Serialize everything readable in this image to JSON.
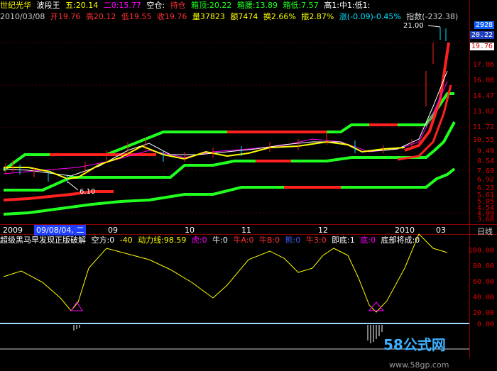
{
  "header": {
    "stock_name": "世纪光华",
    "indicator": "波段王",
    "five_label": "五:20.14",
    "two_label": "二0:15.77",
    "state": "空仓:",
    "hold_label": "持仓",
    "box_top": "箱顶:20.22",
    "box_waist": "箱腰:13.89",
    "box_bottom": "箱低:7.57",
    "high_label": "高1:中1:低1:"
  },
  "quote": {
    "date": "2010/03/08",
    "open": "开19.76",
    "high": "高20.12",
    "low": "低19.55",
    "close": "收19.76",
    "volume": "量37823",
    "amount": "额7474",
    "turnover": "换2.66%",
    "amplitude": "振2.87%",
    "change": "涨(-0.09)-0.45%",
    "index": "指数(-232.38)"
  },
  "price_axis": {
    "labels": [
      "21.00",
      "20.22",
      "19.76",
      "17.86",
      "16.08",
      "14.47",
      "13.02",
      "11.72",
      "10.55",
      "9.49",
      "8.54",
      "7.69",
      "6.92",
      "6.23",
      "5.61",
      "5.05",
      "4.54",
      "4.09",
      "3.68"
    ],
    "top_badge": "2928",
    "current": "19.76",
    "peak_annotation": "21.00",
    "low_annotation": "6.10"
  },
  "time_axis": {
    "labels": [
      "2009",
      "09/08/04, 二",
      "09",
      "10",
      "11",
      "12",
      "2010",
      "03"
    ],
    "period": "日线"
  },
  "lower_panel": {
    "title": "超级黑马早发现正版破解",
    "kong": "空方:0",
    "kong2": "-40",
    "dongli": "动力线:98.59",
    "hu": "虎:0",
    "niu": "牛:0",
    "niu_a": "牛A:0",
    "niu_b": "牛B:0",
    "xiong": "熊:0",
    "niu3": "牛3:0",
    "jidi": "即底:1",
    "di": "底:0",
    "dibu": "底部将成:0",
    "axis": [
      "100.00",
      "80.00",
      "60.00",
      "40.00",
      "20.00",
      "0.00"
    ]
  },
  "watermark": {
    "text": "58公式网",
    "url": "www.58gp.com"
  },
  "colors": {
    "bg": "#000000",
    "up": "#ff2020",
    "down": "#00e0ff",
    "green": "#20ff20",
    "yellow": "#ffff00",
    "magenta": "#ff00ff",
    "grid": "#8b0000"
  }
}
